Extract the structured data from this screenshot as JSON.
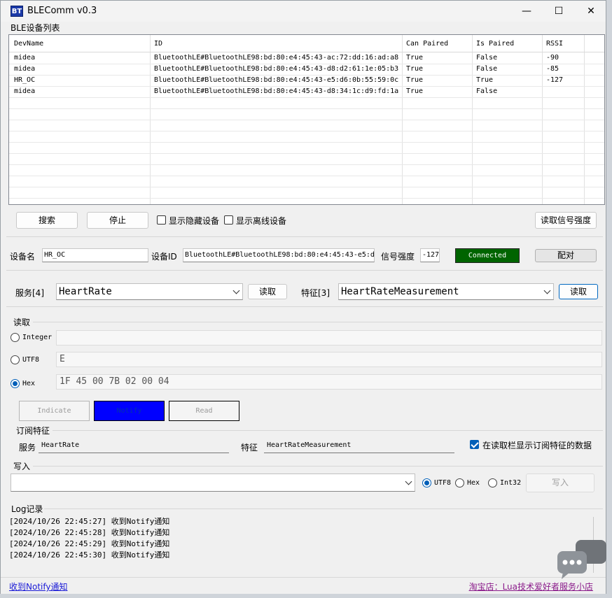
{
  "window": {
    "icon_text": "BT",
    "title": "BLEComm v0.3",
    "minimize_glyph": "—",
    "maximize_glyph": "☐",
    "close_glyph": "✕"
  },
  "device_list": {
    "label": "BLE设备列表",
    "columns": [
      "DevName",
      "ID",
      "Can Paired",
      "Is Paired",
      "RSSI"
    ],
    "rows": [
      [
        "midea",
        "BluetoothLE#BluetoothLE98:bd:80:e4:45:43-ac:72:dd:16:ad:a8",
        "True",
        "False",
        "-90"
      ],
      [
        "midea",
        "BluetoothLE#BluetoothLE98:bd:80:e4:45:43-d8:d2:61:1e:05:b3",
        "True",
        "False",
        "-85"
      ],
      [
        "HR_OC",
        "BluetoothLE#BluetoothLE98:bd:80:e4:45:43-e5:d6:0b:55:59:0c",
        "True",
        "True",
        "-127"
      ],
      [
        "midea",
        "BluetoothLE#BluetoothLE98:bd:80:e4:45:43-d8:34:1c:d9:fd:1a",
        "True",
        "False",
        ""
      ]
    ]
  },
  "scan_bar": {
    "search_label": "搜索",
    "stop_label": "停止",
    "show_hidden_label": "显示隐藏设备",
    "show_offline_label": "显示离线设备",
    "read_rssi_label": "读取信号强度"
  },
  "device_info": {
    "name_label": "设备名",
    "name_value": "HR_OC",
    "id_label": "设备ID",
    "id_value": "BluetoothLE#BluetoothLE98:bd:80:e4:45:43-e5:d",
    "rssi_label": "信号强度",
    "rssi_value": "-127",
    "status": "Connected",
    "status_color": "#006400",
    "pair_label": "配对"
  },
  "service_bar": {
    "service_label": "服务[4]",
    "service_value": "HeartRate",
    "read_service_label": "读取",
    "char_label": "特征[3]",
    "char_value": "HeartRateMeasurement",
    "read_char_label": "读取"
  },
  "read_group": {
    "label": "读取",
    "integer_label": "Integer",
    "integer_value": "",
    "utf8_label": "UTF8",
    "utf8_value": "E",
    "hex_label": "Hex",
    "hex_value": "1F 45 00 7B 02 00 04",
    "indicate_label": "Indicate",
    "notify_label": "Notify",
    "notify_color": "#0000ff",
    "read_label": "Read"
  },
  "subscribe_group": {
    "label": "订阅特征",
    "service_label": "服务",
    "service_value": "HeartRate",
    "char_label": "特征",
    "char_value": "HeartRateMeasurement",
    "show_sub_label": "在读取栏显示订阅特征的数据"
  },
  "write_group": {
    "label": "写入",
    "input_value": "",
    "utf8_label": "UTF8",
    "hex_label": "Hex",
    "int32_label": "Int32",
    "write_label": "写入"
  },
  "log": {
    "label": "Log记录",
    "lines": [
      "[2024/10/26 22:45:27] 收到Notify通知",
      "[2024/10/26 22:45:28] 收到Notify通知",
      "[2024/10/26 22:45:29] 收到Notify通知",
      "[2024/10/26 22:45:30] 收到Notify通知"
    ]
  },
  "status_bar": {
    "left_text": "收到Notify通知",
    "right_text": "淘宝店：Lua技术爱好者服务小店"
  }
}
